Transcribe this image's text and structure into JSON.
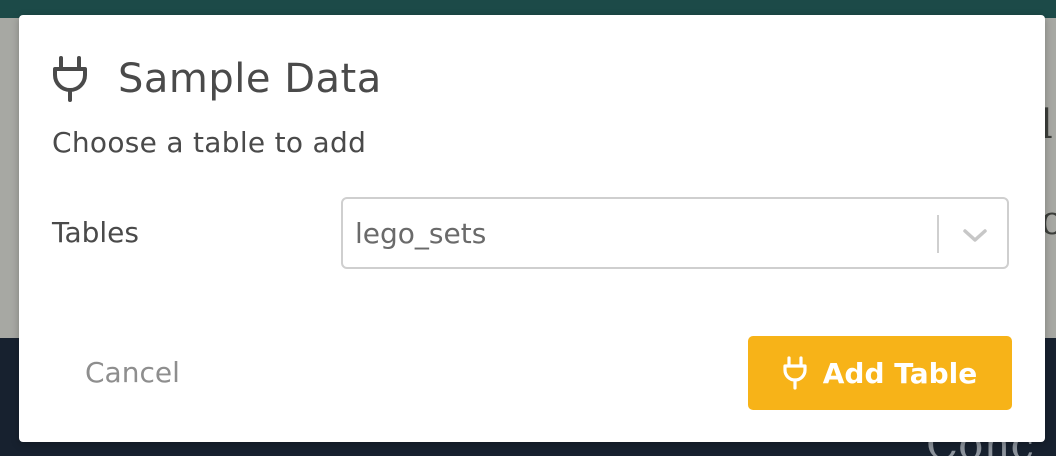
{
  "background": {
    "peek_text_1": "l",
    "peek_text_2": "o",
    "peek_text_3": "Conc"
  },
  "modal": {
    "icon": "plug-icon",
    "title": "Sample Data",
    "subtitle": "Choose a table to add",
    "tables_field": {
      "label": "Tables",
      "selected_value": "lego_sets",
      "dropdown_icon": "chevron-down-icon"
    },
    "cancel_label": "Cancel",
    "add_button": {
      "icon": "plug-icon",
      "label": "Add Table"
    }
  },
  "colors": {
    "accent": "#f7b318",
    "text": "#4a4a4a",
    "muted": "#8e8e8e",
    "border": "#cfcfcf",
    "topbar": "#1c4a48",
    "bottom_bg": "#17212f"
  }
}
